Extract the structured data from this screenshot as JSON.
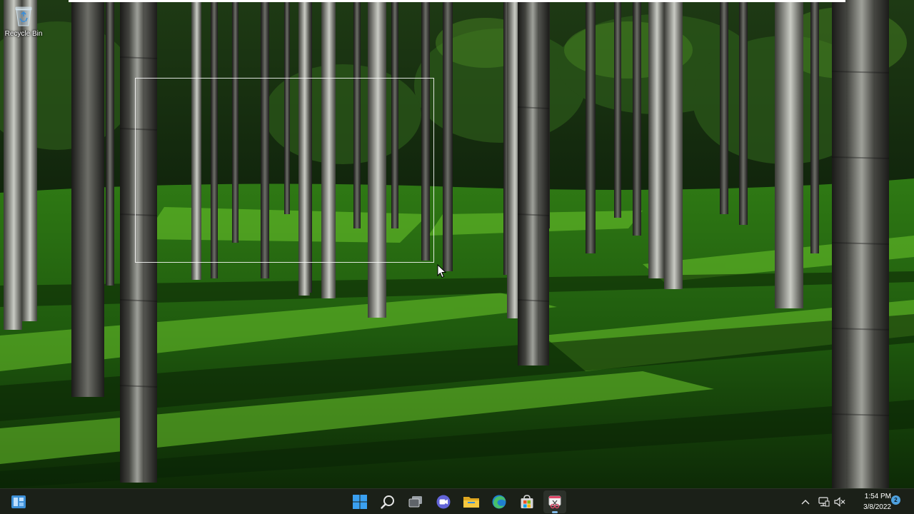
{
  "desktop": {
    "icons": [
      {
        "label": "Recycle Bin",
        "icon": "recycle-bin-icon"
      }
    ]
  },
  "taskbar": {
    "left_widget": "widgets-icon",
    "apps": [
      {
        "name": "Start",
        "icon": "windows-logo-icon"
      },
      {
        "name": "Search",
        "icon": "search-icon"
      },
      {
        "name": "Task View",
        "icon": "task-view-icon"
      },
      {
        "name": "Chat",
        "icon": "chat-icon"
      },
      {
        "name": "File Explorer",
        "icon": "folder-icon"
      },
      {
        "name": "Microsoft Edge",
        "icon": "edge-icon"
      },
      {
        "name": "Microsoft Store",
        "icon": "store-icon"
      },
      {
        "name": "Snipping Tool",
        "icon": "snipping-tool-icon"
      }
    ],
    "tray": {
      "overflow_icon": "chevron-up-icon",
      "network_icon": "network-icon",
      "volume_icon": "volume-muted-icon"
    },
    "clock": {
      "time": "1:54 PM",
      "date": "3/8/2022"
    },
    "notification_count": "2"
  },
  "colors": {
    "taskbar_bg": "#1b2018",
    "accent": "#4ea1de",
    "grass": "#3f9a1c"
  }
}
